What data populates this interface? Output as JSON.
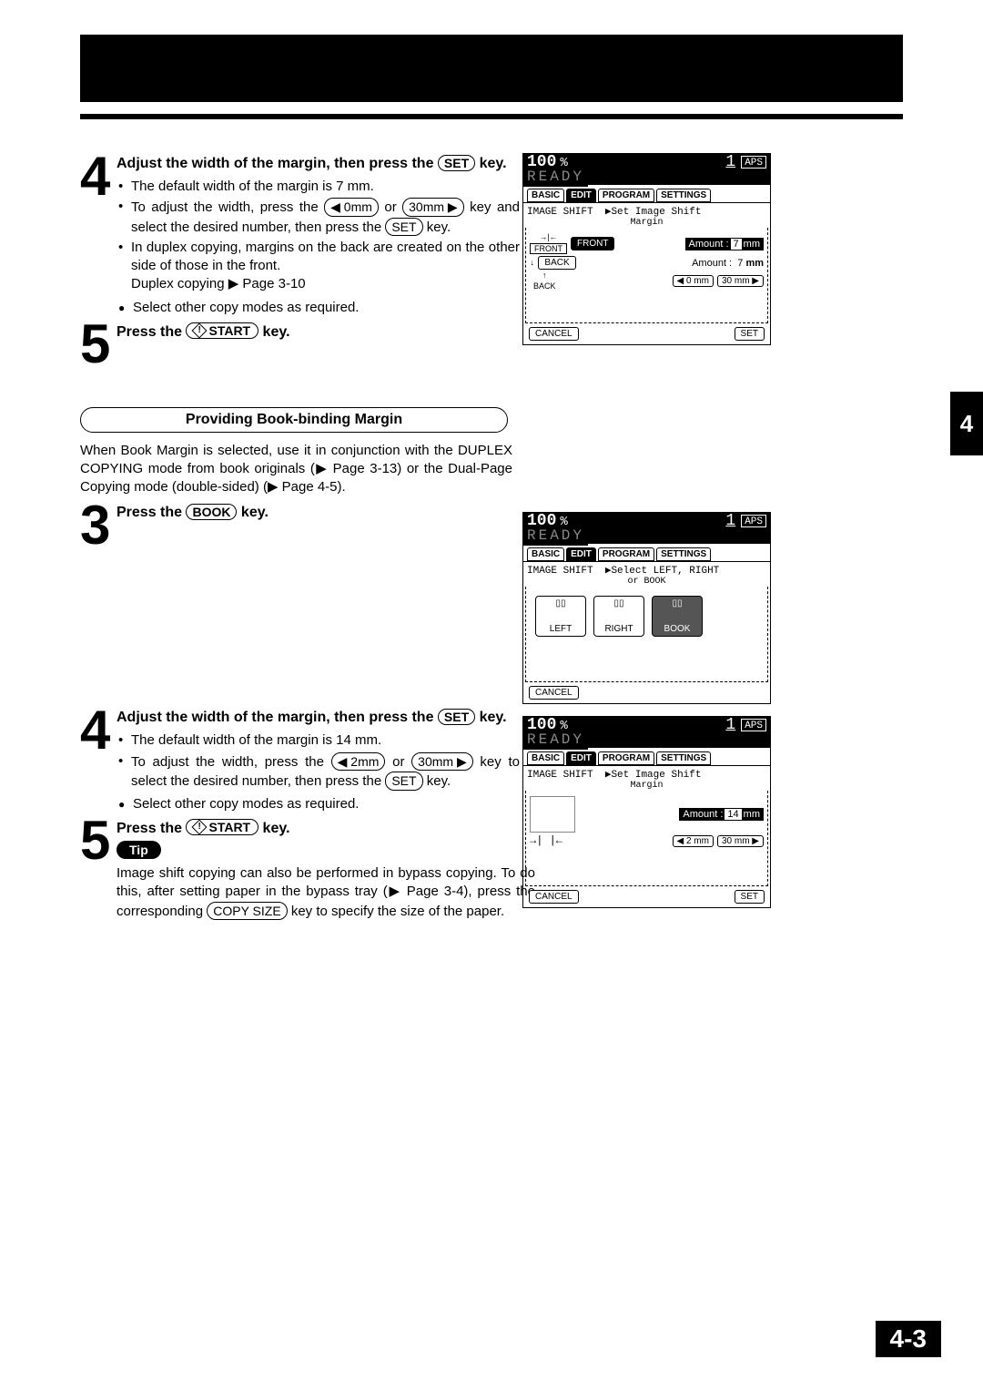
{
  "page": {
    "tab": "4",
    "number": "4-3"
  },
  "section1": {
    "step4": {
      "num": "4",
      "title_a": "Adjust the width of the margin, then press the ",
      "title_key": "SET",
      "title_b": " key.",
      "b1": "The default width of the margin is 7 mm.",
      "b2a": "To adjust the width, press the ",
      "b2k1": "◀ 0mm",
      "b2mid": " or ",
      "b2k2": "30mm ▶",
      "b2b": " key and select the desired number, then press the ",
      "b2k3": "SET",
      "b2c": " key.",
      "b3a": "In duplex copying, margins on the back are created on the other side of those in the front.",
      "b3ref": "Duplex copying ▶ Page 3-10",
      "dot": "Select other copy modes as required."
    },
    "step5": {
      "num": "5",
      "title_a": "Press the ",
      "title_key": "START",
      "title_b": " key."
    }
  },
  "heading": "Providing Book-binding Margin",
  "bookpara_a": "When Book Margin is selected, use it in conjunction with the DUPLEX COPYING mode from book originals (▶ Page 3-13) or the Dual-Page Copying mode (double-sided) (▶ Page 4-5).",
  "section2": {
    "step3": {
      "num": "3",
      "title_a": "Press the ",
      "title_key": "BOOK",
      "title_b": " key."
    },
    "step4": {
      "num": "4",
      "title_a": "Adjust the width of the margin, then press the ",
      "title_key": "SET",
      "title_b": " key.",
      "b1": "The default width of the margin is 14 mm.",
      "b2a": "To adjust the width, press the ",
      "b2k1": "◀ 2mm",
      "b2mid": " or ",
      "b2k2": "30mm ▶",
      "b2b": " key to select the desired number, then press the ",
      "b2k3": "SET",
      "b2c": " key.",
      "dot": "Select other copy modes as required."
    },
    "step5": {
      "num": "5",
      "title_a": "Press the ",
      "title_key": "START",
      "title_b": "  key."
    },
    "tip": {
      "label": "Tip",
      "text_a": "Image shift copying can also be performed in bypass copying. To do this, after setting paper in the bypass tray (▶ Page 3-4), press the corresponding ",
      "text_key": "COPY SIZE",
      "text_b": " key to specify the size of the paper."
    }
  },
  "lcd": {
    "zoom": "100",
    "pct": "%",
    "copies": "1",
    "aps": "APS",
    "ready": "READY",
    "tabs": {
      "basic": "BASIC",
      "edit": "EDIT",
      "program": "PROGRAM",
      "settings": "SETTINGS"
    },
    "breadcrumb": "IMAGE SHIFT",
    "fig1": {
      "sub1": "▶Set Image Shift",
      "sub2": "Margin",
      "front": "FRONT",
      "back": "BACK",
      "amount": "Amount :",
      "val_front": "7",
      "val_back": "7",
      "mm": "mm",
      "dec": "◀  0 mm",
      "inc": "30 mm  ▶",
      "cancel": "CANCEL",
      "set": "SET",
      "lfront": "FRONT",
      "lback": "BACK"
    },
    "fig2": {
      "sub1": "▶Select LEFT, RIGHT",
      "sub2": "or BOOK",
      "left": "LEFT",
      "right": "RIGHT",
      "book": "BOOK",
      "cancel": "CANCEL"
    },
    "fig3": {
      "sub1": "▶Set Image Shift",
      "sub2": "Margin",
      "amount": "Amount :",
      "val": "14",
      "mm": "mm",
      "dec": "◀  2 mm",
      "inc": "30 mm  ▶",
      "cancel": "CANCEL",
      "set": "SET"
    }
  }
}
